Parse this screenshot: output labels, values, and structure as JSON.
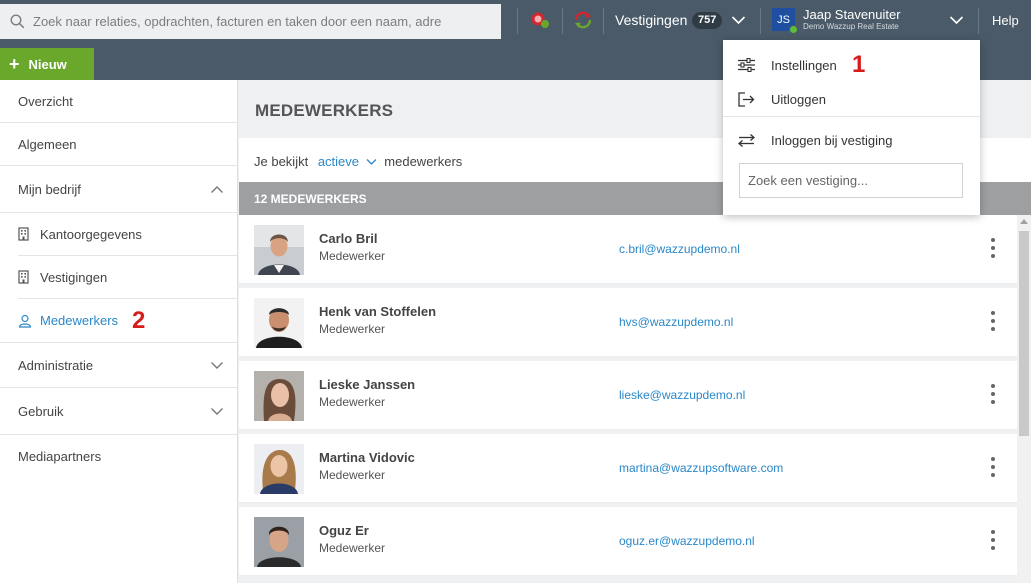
{
  "header": {
    "search_placeholder": "Zoek naar relaties, opdrachten, facturen en taken door een naam, adre",
    "vestigingen_label": "Vestigingen",
    "vestigingen_count": "757",
    "user_initials": "JS",
    "user_name": "Jaap Stavenuiter",
    "user_company": "Demo Wazzup Real Estate",
    "help_label": "Help",
    "new_button": "Nieuw"
  },
  "dropdown": {
    "items": [
      {
        "label": "Instellingen",
        "icon": "sliders-icon"
      },
      {
        "label": "Uitloggen",
        "icon": "logout-icon"
      },
      {
        "label": "Inloggen bij vestiging",
        "icon": "swap-icon"
      }
    ],
    "search_placeholder": "Zoek een vestiging..."
  },
  "sidebar": {
    "items": [
      {
        "label": "Overzicht"
      },
      {
        "label": "Algemeen"
      },
      {
        "label": "Mijn bedrijf",
        "expanded": true
      },
      {
        "label": "Administratie"
      },
      {
        "label": "Gebruik"
      },
      {
        "label": "Mediapartners"
      }
    ],
    "subitems": [
      {
        "label": "Kantoorgegevens",
        "icon": "building-icon"
      },
      {
        "label": "Vestigingen",
        "icon": "building-icon"
      },
      {
        "label": "Medewerkers",
        "icon": "user-icon",
        "active": true
      }
    ]
  },
  "main": {
    "title": "MEDEWERKERS",
    "filter_prefix": "Je bekijkt",
    "filter_value": "actieve",
    "filter_suffix": "medewerkers",
    "count_label": "12 MEDEWERKERS",
    "employees": [
      {
        "name": "Carlo Bril",
        "role": "Medewerker",
        "email": "c.bril@wazzupdemo.nl"
      },
      {
        "name": "Henk van Stoffelen",
        "role": "Medewerker",
        "email": "hvs@wazzupdemo.nl"
      },
      {
        "name": "Lieske Janssen",
        "role": "Medewerker",
        "email": "lieske@wazzupdemo.nl"
      },
      {
        "name": "Martina Vidovic",
        "role": "Medewerker",
        "email": "martina@wazzupsoftware.com"
      },
      {
        "name": "Oguz Er",
        "role": "Medewerker",
        "email": "oguz.er@wazzupdemo.nl"
      }
    ]
  },
  "markers": {
    "one": "1",
    "two": "2"
  },
  "colors": {
    "accent": "#2a88c8",
    "new_button": "#6aa82b",
    "header": "#4a5a68",
    "marker": "#d81b1b"
  }
}
